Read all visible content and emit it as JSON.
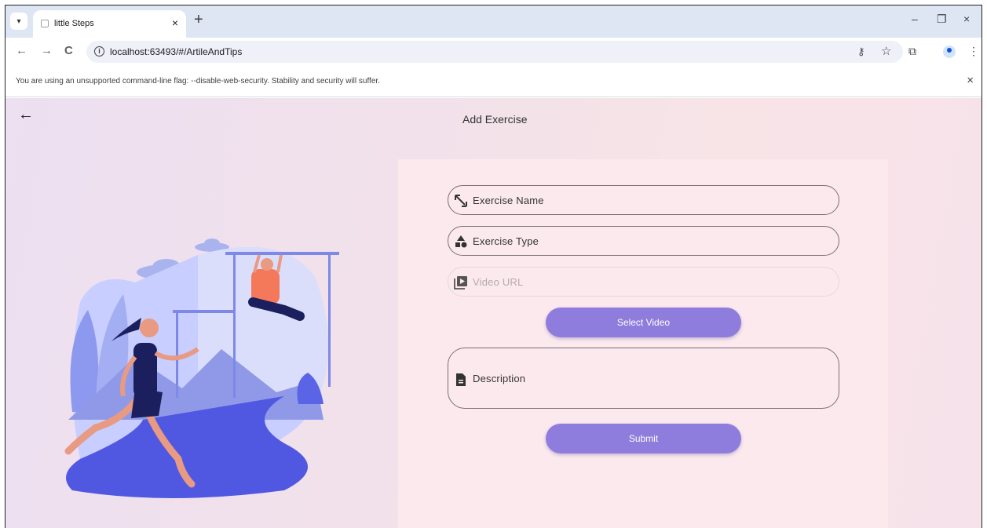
{
  "browser": {
    "tab_title": "little Steps",
    "tab_close": "×",
    "new_tab": "+",
    "url": "localhost:63493/#/ArtileAndTips",
    "info_icon": "i",
    "win_min": "–",
    "win_restore": "❐",
    "win_close": "×",
    "nav_back": "←",
    "nav_forward": "→",
    "nav_reload": "C",
    "key_icon": "⚷",
    "star_icon": "☆",
    "ext_icon": "⧉",
    "menu_icon": "⋮",
    "tab_menu_icon": "▾"
  },
  "infobar": {
    "message": "You are using an unsupported command-line flag: --disable-web-security. Stability and security will suffer.",
    "close": "×"
  },
  "page": {
    "back": "←",
    "title": "Add Exercise"
  },
  "form": {
    "exercise_name": "Exercise Name",
    "exercise_type": "Exercise Type",
    "video_url": "Video URL",
    "select_video": "Select Video",
    "description": "Description",
    "submit": "Submit"
  },
  "colors": {
    "button": "#8e7ddd",
    "field_border": "#7a6f7a",
    "illustration_blue": "#5b63e6"
  }
}
